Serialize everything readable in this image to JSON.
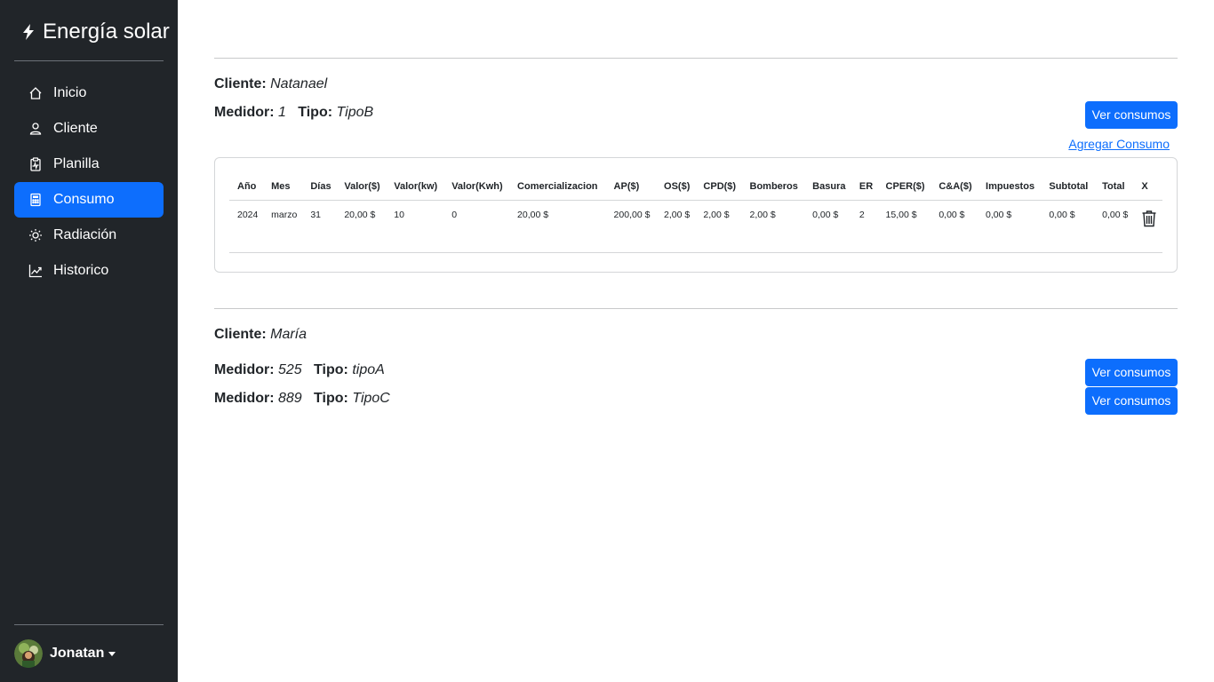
{
  "app": {
    "brand": "Energía solar"
  },
  "sidebar": {
    "items": [
      {
        "label": "Inicio",
        "icon": "house-icon"
      },
      {
        "label": "Cliente",
        "icon": "person-icon"
      },
      {
        "label": "Planilla",
        "icon": "clipboard-pulse-icon"
      },
      {
        "label": "Consumo",
        "icon": "calculator-icon",
        "active": true
      },
      {
        "label": "Radiación",
        "icon": "sun-icon"
      },
      {
        "label": "Historico",
        "icon": "graph-up-icon"
      }
    ],
    "user": {
      "name": "Jonatan"
    }
  },
  "clients": [
    {
      "label": "Cliente:",
      "name": "Natanael",
      "meters": [
        {
          "medidor_label": "Medidor:",
          "medidor": "1",
          "tipo_label": "Tipo:",
          "tipo": "TipoB",
          "button": "Ver consumos"
        }
      ],
      "add_link": "Agregar Consumo",
      "table": {
        "headers": [
          "Año",
          "Mes",
          "Días",
          "Valor($)",
          "Valor(kw)",
          "Valor(Kwh)",
          "Comercializacion",
          "AP($)",
          "OS($)",
          "CPD($)",
          "Bomberos",
          "Basura",
          "ER",
          "CPER($)",
          "C&A($)",
          "Impuestos",
          "Subtotal",
          "Total",
          "X"
        ],
        "rows": [
          [
            "2024",
            "marzo",
            "31",
            "20,00 $",
            "10",
            "0",
            "20,00 $",
            "200,00 $",
            "2,00 $",
            "2,00 $",
            "2,00 $",
            "0,00 $",
            "2",
            "15,00 $",
            "0,00 $",
            "0,00 $",
            "0,00 $",
            "0,00 $"
          ]
        ]
      }
    },
    {
      "label": "Cliente:",
      "name": "María",
      "meters": [
        {
          "medidor_label": "Medidor:",
          "medidor": "525",
          "tipo_label": "Tipo:",
          "tipo": "tipoA",
          "button": "Ver consumos"
        },
        {
          "medidor_label": "Medidor:",
          "medidor": "889",
          "tipo_label": "Tipo:",
          "tipo": "TipoC",
          "button": "Ver consumos"
        }
      ]
    }
  ],
  "colors": {
    "sidebar_bg": "#212529",
    "accent": "#0d6efd"
  }
}
